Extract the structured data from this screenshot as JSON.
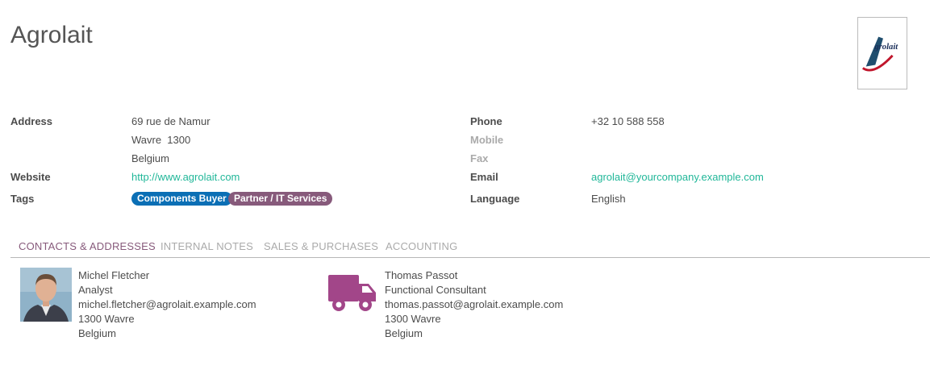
{
  "partner": {
    "name": "Agrolait",
    "logo_text": "Agrolait"
  },
  "fields": {
    "address_label": "Address",
    "address_street": "69 rue de Namur",
    "address_city": "Wavre  1300",
    "address_country": "Belgium",
    "website_label": "Website",
    "website_value": "http://www.agrolait.com",
    "tags_label": "Tags",
    "tags": [
      {
        "label": "Components Buyer",
        "color": "#0b6fb5"
      },
      {
        "label": "Partner / IT Services",
        "color": "#875a7b"
      }
    ],
    "phone_label": "Phone",
    "phone_value": "+32 10 588 558",
    "mobile_label": "Mobile",
    "fax_label": "Fax",
    "email_label": "Email",
    "email_value": "agrolait@yourcompany.example.com",
    "language_label": "Language",
    "language_value": "English"
  },
  "tabs": [
    {
      "label": "CONTACTS & ADDRESSES",
      "active": true
    },
    {
      "label": "INTERNAL NOTES",
      "active": false
    },
    {
      "label": "SALES & PURCHASES",
      "active": false
    },
    {
      "label": "ACCOUNTING",
      "active": false
    }
  ],
  "contacts": [
    {
      "icon": "person-photo",
      "lines": [
        "Michel Fletcher",
        "Analyst",
        "michel.fletcher@agrolait.example.com",
        "1300 Wavre",
        "Belgium"
      ]
    },
    {
      "icon": "truck-icon",
      "lines": [
        "Thomas Passot",
        "Functional Consultant",
        "thomas.passot@agrolait.example.com",
        "1300 Wavre",
        "Belgium"
      ]
    }
  ],
  "colors": {
    "accent": "#875a7b",
    "link": "#21b799",
    "tag_blue": "#0b6fb5",
    "tag_purple": "#875a7b"
  }
}
